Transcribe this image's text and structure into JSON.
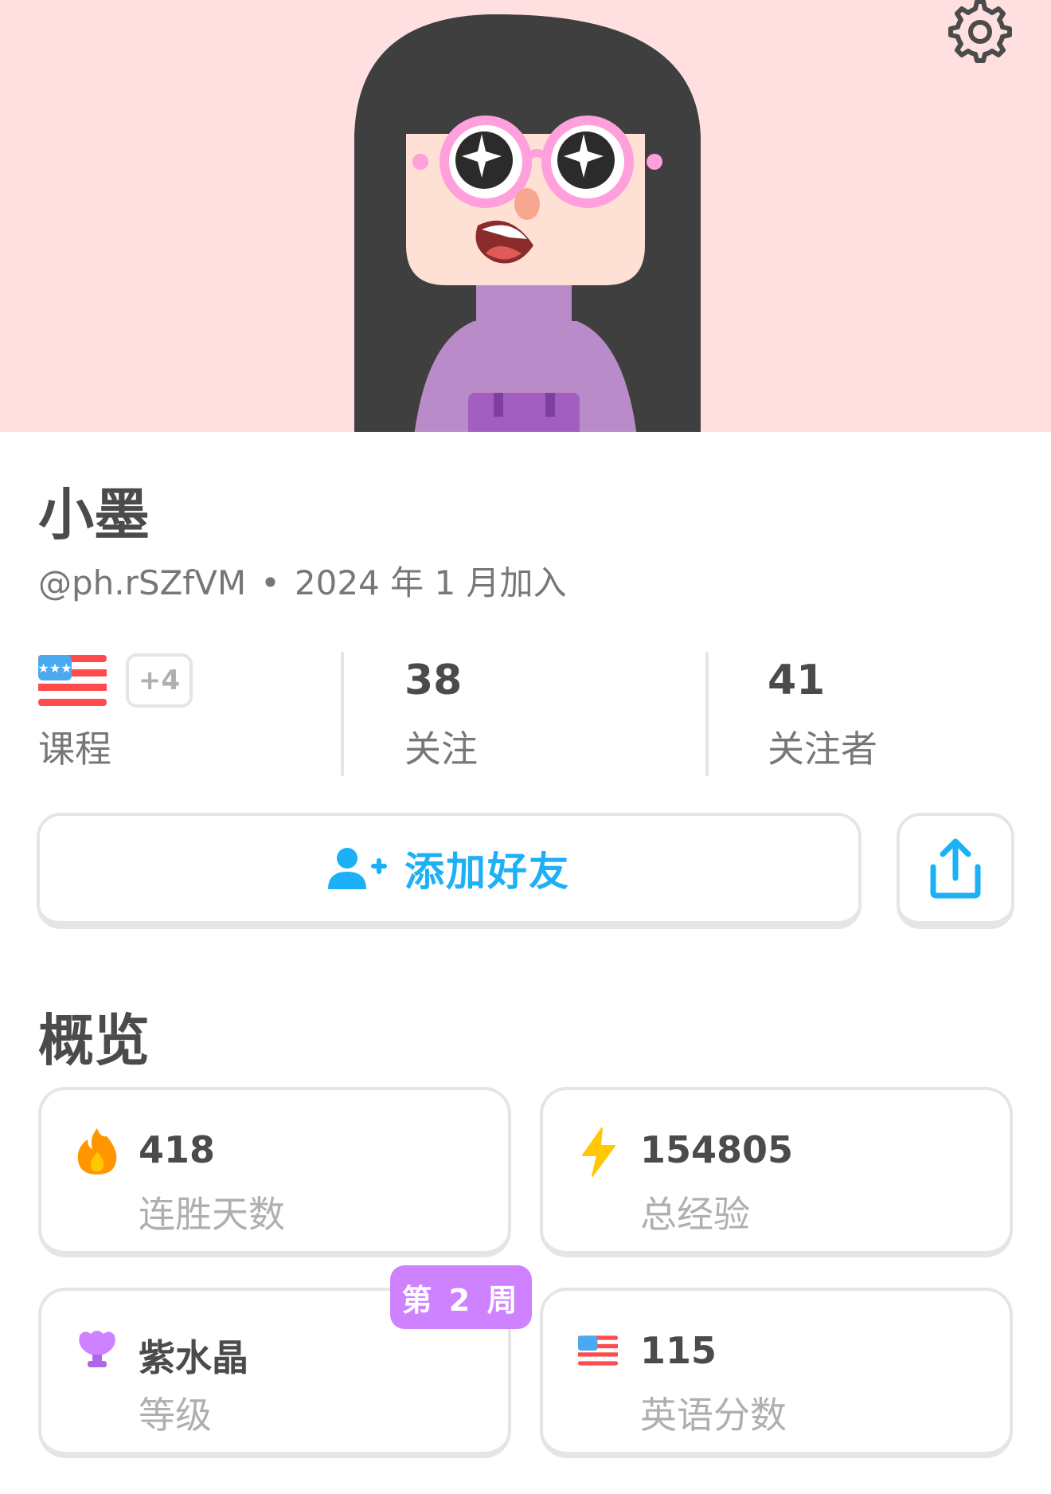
{
  "profile": {
    "name": "小墨",
    "handle": "@ph.rSZfVM",
    "separator": "•",
    "joined": "2024 年 1 月加入"
  },
  "stats": {
    "courses": {
      "flag_icon": "us-flag-icon",
      "extra": "+4",
      "label": "课程"
    },
    "following": {
      "count": "38",
      "label": "关注"
    },
    "followers": {
      "count": "41",
      "label": "关注者"
    }
  },
  "actions": {
    "add_friend": "添加好友",
    "share_icon": "share-icon"
  },
  "overview": {
    "title": "概览",
    "cards": {
      "streak": {
        "value": "418",
        "label": "连胜天数",
        "icon": "flame-icon"
      },
      "xp": {
        "value": "154805",
        "label": "总经验",
        "icon": "lightning-icon"
      },
      "league": {
        "value": "紫水晶",
        "label": "等级",
        "icon": "amethyst-trophy-icon",
        "badge": "第 2 周"
      },
      "score": {
        "value": "115",
        "label": "英语分数",
        "icon": "us-flag-icon"
      }
    }
  },
  "colors": {
    "hero_bg": "#ffdfe0",
    "accent_blue": "#1cb0f6",
    "badge_purple": "#ce82ff"
  }
}
